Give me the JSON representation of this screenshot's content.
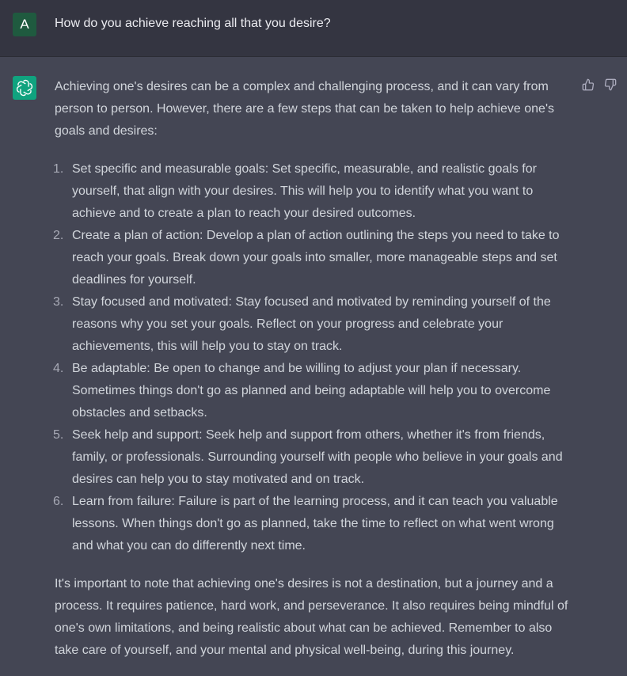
{
  "user": {
    "avatar_letter": "A",
    "avatar_color": "#1f5a3f",
    "message": "How do you achieve reaching all that you desire?"
  },
  "assistant": {
    "avatar_icon": "openai-logo-icon",
    "avatar_color": "#10a37f",
    "intro": "Achieving one's desires can be a complex and challenging process, and it can vary from person to person. However, there are a few steps that can be taken to help achieve one's goals and desires:",
    "steps": [
      {
        "num": "1.",
        "text": "Set specific and measurable goals: Set specific, measurable, and realistic goals for yourself, that align with your desires. This will help you to identify what you want to achieve and to create a plan to reach your desired outcomes."
      },
      {
        "num": "2.",
        "text": "Create a plan of action: Develop a plan of action outlining the steps you need to take to reach your goals. Break down your goals into smaller, more manageable steps and set deadlines for yourself."
      },
      {
        "num": "3.",
        "text": "Stay focused and motivated: Stay focused and motivated by reminding yourself of the reasons why you set your goals. Reflect on your progress and celebrate your achievements, this will help you to stay on track."
      },
      {
        "num": "4.",
        "text": "Be adaptable: Be open to change and be willing to adjust your plan if necessary. Sometimes things don't go as planned and being adaptable will help you to overcome obstacles and setbacks."
      },
      {
        "num": "5.",
        "text": "Seek help and support: Seek help and support from others, whether it's from friends, family, or professionals. Surrounding yourself with people who believe in your goals and desires can help you to stay motivated and on track."
      },
      {
        "num": "6.",
        "text": "Learn from failure: Failure is part of the learning process, and it can teach you valuable lessons. When things don't go as planned, take the time to reflect on what went wrong and what you can do differently next time."
      }
    ],
    "conclusion": "It's important to note that achieving one's desires is not a destination, but a journey and a process. It requires patience, hard work, and perseverance. It also requires being mindful of one's own limitations, and being realistic about what can be achieved. Remember to also take care of yourself, and your mental and physical well-being, during this journey."
  },
  "feedback": {
    "up_icon": "thumbs-up-icon",
    "down_icon": "thumbs-down-icon"
  }
}
